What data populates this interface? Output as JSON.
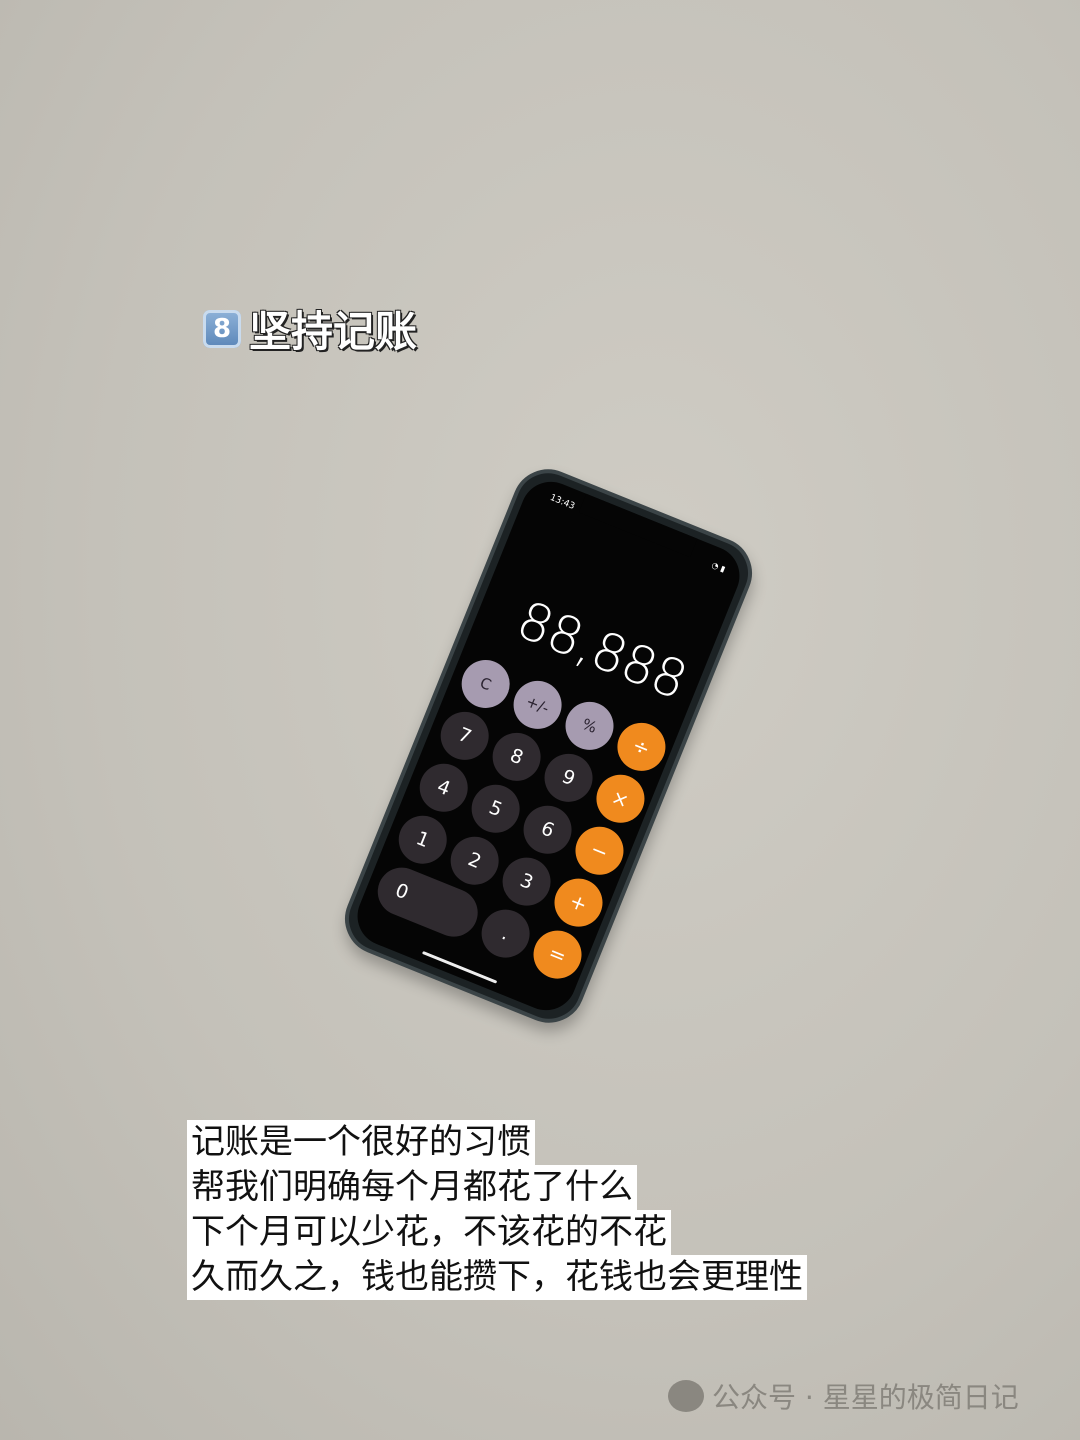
{
  "title": {
    "number": "8",
    "text": "坚持记账"
  },
  "phone": {
    "time": "13:43",
    "status": "wifi battery",
    "display": "88,888",
    "keys": [
      "C",
      "+/-",
      "%",
      "÷",
      "7",
      "8",
      "9",
      "×",
      "4",
      "5",
      "6",
      "−",
      "1",
      "2",
      "3",
      "+",
      "0",
      ".",
      "="
    ]
  },
  "caption": [
    "记账是一个很好的习惯",
    "帮我们明确每个月都花了什么",
    "下个月可以少花，不该花的不花",
    "久而久之，钱也能攒下，花钱也会更理性"
  ],
  "watermark": "公众号 · 星星的极简日记",
  "colors": {
    "operator": "#f08a1e",
    "function": "#a69bb0",
    "digit": "#2f2a2f"
  }
}
